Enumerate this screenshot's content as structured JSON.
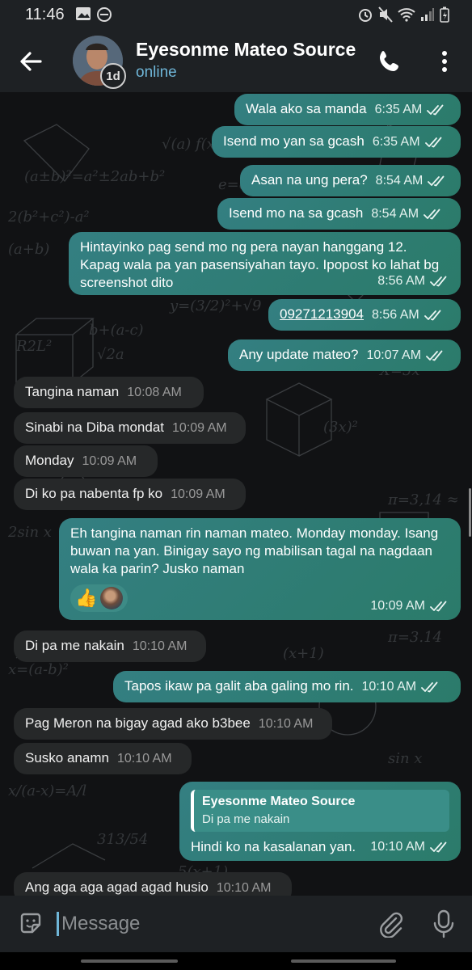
{
  "status_bar": {
    "time": "11:46"
  },
  "header": {
    "contact_name": "Eyesonme Mateo Source",
    "status": "online",
    "story_badge": "1d"
  },
  "messages": [
    {
      "dir": "out",
      "text": "Wala ako sa manda",
      "time": "6:35 AM",
      "read": true
    },
    {
      "dir": "out",
      "text": "Isend mo yan sa gcash",
      "time": "6:35 AM",
      "read": true
    },
    {
      "dir": "out",
      "text": "Asan na ung pera?",
      "time": "8:54 AM",
      "read": true
    },
    {
      "dir": "out",
      "text": "Isend mo na sa gcash",
      "time": "8:54 AM",
      "read": true
    },
    {
      "dir": "out",
      "text": "Hintayinko pag send mo ng pera nayan hanggang 12. Kapag wala pa yan pasensiyahan tayo. Ipopost ko lahat bg screenshot dito",
      "time": "8:56 AM",
      "read": true
    },
    {
      "dir": "out",
      "text": "09271213904",
      "time": "8:56 AM",
      "read": true,
      "link": true
    },
    {
      "dir": "out",
      "text": "Any update mateo?",
      "time": "10:07 AM",
      "read": true
    },
    {
      "dir": "in",
      "text": "Tangina naman",
      "time": "10:08 AM"
    },
    {
      "dir": "in",
      "text": "Sinabi na Diba mondat",
      "time": "10:09 AM"
    },
    {
      "dir": "in",
      "text": "Monday",
      "time": "10:09 AM"
    },
    {
      "dir": "in",
      "text": "Di ko pa nabenta fp ko",
      "time": "10:09 AM"
    },
    {
      "dir": "out",
      "text": "Eh tangina naman rin naman mateo. Monday monday. Isang buwan na yan. Binigay sayo ng mabilisan tagal na nagdaan wala ka parin? Jusko naman",
      "time": "10:09 AM",
      "read": true,
      "reaction": "👍"
    },
    {
      "dir": "in",
      "text": "Di pa me nakain",
      "time": "10:10 AM"
    },
    {
      "dir": "out",
      "text": "Tapos ikaw pa galit aba galing mo rin.",
      "time": "10:10 AM",
      "read": true
    },
    {
      "dir": "in",
      "text": "Pag Meron na bigay agad ako b3bee",
      "time": "10:10 AM"
    },
    {
      "dir": "in",
      "text": "Susko anamn",
      "time": "10:10 AM"
    },
    {
      "dir": "out",
      "text": "Hindi ko na kasalanan yan.",
      "time": "10:10 AM",
      "read": true,
      "reply_to": {
        "name": "Eyesonme Mateo Source",
        "text": "Di pa me nakain"
      }
    },
    {
      "dir": "in",
      "text": "Ang aga aga agad agad husio",
      "time": "10:10 AM"
    }
  ],
  "input": {
    "placeholder": "Message"
  },
  "icons": {
    "back": "arrow-left-icon",
    "call": "phone-icon",
    "menu": "more-vertical-icon",
    "emoji": "sticker-emoji-icon",
    "attach": "paperclip-icon",
    "mic": "microphone-icon",
    "read": "double-check-icon"
  },
  "colors": {
    "bar": "#1e2124",
    "outgoing": "#2e7b72",
    "incoming": "#262829",
    "accent": "#6fb6d8"
  }
}
